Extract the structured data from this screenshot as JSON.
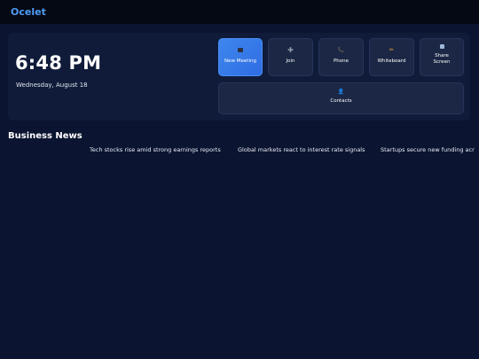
{
  "app": {
    "title": "Ocelet"
  },
  "hero": {
    "time": "6:48 PM",
    "date": "Wednesday, August 18"
  },
  "actions": [
    {
      "label": "New Meeting",
      "icon": "video-camera-icon",
      "primary": true
    },
    {
      "label": "Join",
      "icon": "plus-icon"
    },
    {
      "label": "Phone",
      "icon": "phone-icon"
    },
    {
      "label": "Whiteboard",
      "icon": "pencil-icon"
    },
    {
      "label": "Share Screen",
      "icon": "share-screen-icon"
    },
    {
      "label": "Contacts",
      "icon": "contacts-icon"
    }
  ],
  "news": {
    "title": "Business News",
    "headlines": [
      "Tech stocks rise amid strong earnings reports",
      "Global markets react to interest rate signals",
      "Startups secure new funding acr"
    ]
  },
  "colors": {
    "background": "#0b1430",
    "topbar": "#050914",
    "accent": "#3e86ee",
    "brand": "#4f9cf3"
  }
}
